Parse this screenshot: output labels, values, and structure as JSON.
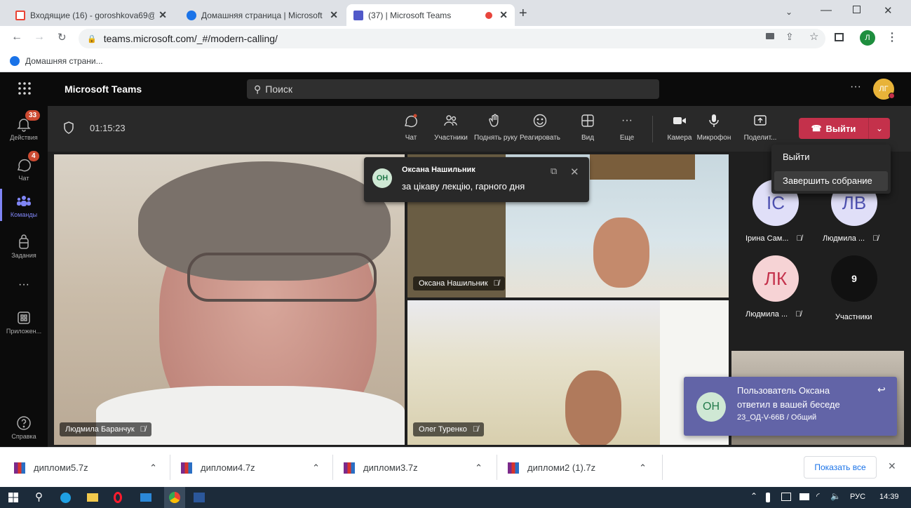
{
  "browser": {
    "tabs": [
      {
        "title": "Входящие (16) - goroshkova69@",
        "favicon": "gmail-icon"
      },
      {
        "title": "Домашняя страница | Microsoft",
        "favicon": "office-icon"
      },
      {
        "title": "(37) | Microsoft Teams",
        "favicon": "teams-icon"
      }
    ],
    "url": "teams.microsoft.com/_#/modern-calling/",
    "bookmark": "Домашняя страни...",
    "profile_initial": "Л"
  },
  "teams": {
    "app_name": "Microsoft Teams",
    "search_placeholder": "Поиск",
    "user_initials": "ЛГ",
    "rail": [
      {
        "label": "Действия",
        "badge": "33"
      },
      {
        "label": "Чат",
        "badge": "4"
      },
      {
        "label": "Команды",
        "badge": ""
      },
      {
        "label": "Задания",
        "badge": ""
      },
      {
        "label": "Приложен...",
        "badge": ""
      },
      {
        "label": "Справка",
        "badge": ""
      }
    ],
    "meeting": {
      "timer": "01:15:23",
      "controls": {
        "chat": "Чат",
        "participants": "Участники",
        "raise_hand": "Поднять руку",
        "react": "Реагировать",
        "view": "Вид",
        "more": "Еще",
        "camera": "Камера",
        "mic": "Микрофон",
        "share": "Поделит..."
      },
      "leave_label": "Выйти",
      "leave_menu": [
        "Выйти",
        "Завершить собрание"
      ]
    },
    "chat_bubble": {
      "initials": "ОН",
      "name": "Оксана Нашильник",
      "message": "за цікаву лекцію, гарного дня"
    },
    "tiles": [
      {
        "name": "Людмила Баранчук"
      },
      {
        "name": "Оксана Нашильник"
      },
      {
        "name": "Олег Туренко"
      }
    ],
    "roster": [
      {
        "initials": "ІС",
        "name": "Ірина Сам...",
        "color": "#e0dff8",
        "text_color": "#4f52b2"
      },
      {
        "initials": "ЛВ",
        "name": "Людмила ...",
        "color": "#e0dff8",
        "text_color": "#4f52b2"
      },
      {
        "initials": "ЛК",
        "name": "Людмила ...",
        "color": "#f6d3d5",
        "text_color": "#c4314b"
      },
      {
        "initials": "9",
        "name": "Участники",
        "color": "#111111",
        "text_color": "#ffffff"
      }
    ],
    "toast": {
      "initials": "ОН",
      "line1": "Пользователь Оксана",
      "line2": "ответил в вашей беседе",
      "line3": "23_ОД-V-66В / Общий"
    }
  },
  "downloads": {
    "files": [
      "дипломи5.7z",
      "дипломи4.7z",
      "дипломи3.7z",
      "дипломи2 (1).7z"
    ],
    "show_all": "Показать все"
  },
  "taskbar": {
    "lang": "РУС",
    "time": "14:39"
  },
  "colors": {
    "teams_purple": "#6264a7",
    "leave_red": "#c4314b",
    "badge_red": "#cc4a31"
  }
}
